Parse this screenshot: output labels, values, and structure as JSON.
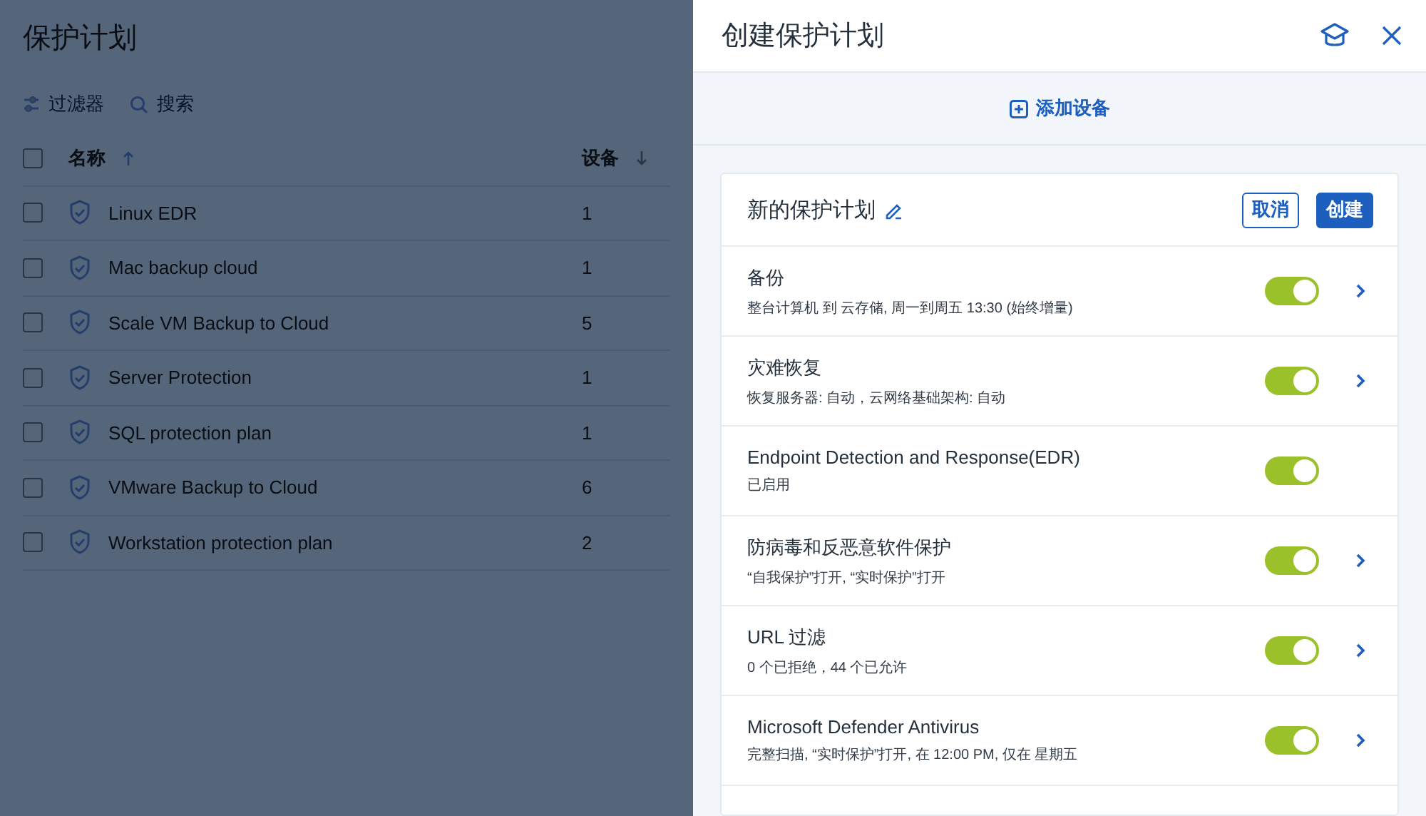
{
  "page": {
    "title": "保护计划",
    "toolbar": [
      "过滤器",
      "搜索"
    ],
    "table": {
      "columns": [
        "名称",
        "设备"
      ],
      "all_checked": false,
      "rows": [
        {
          "name": "Linux EDR",
          "devices": "1",
          "checked": false
        },
        {
          "name": "Mac backup cloud",
          "devices": "1",
          "checked": false
        },
        {
          "name": "Scale VM Backup to Cloud",
          "devices": "5",
          "checked": false
        },
        {
          "name": "Server Protection",
          "devices": "1",
          "checked": false
        },
        {
          "name": "SQL protection plan",
          "devices": "1",
          "checked": false
        },
        {
          "name": "VMware Backup to Cloud",
          "devices": "6",
          "checked": false
        },
        {
          "name": "Workstation protection plan",
          "devices": "2",
          "checked": false
        }
      ]
    }
  },
  "panel": {
    "title": "创建保护计划",
    "add_device": "添加设备",
    "plan": {
      "name": "新的保护计划",
      "buttons": [
        {
          "label": "取消",
          "kind": "secondary"
        },
        {
          "label": "创建",
          "kind": "primary"
        }
      ],
      "modules": [
        {
          "title": "备份",
          "summary": "整台计算机 到 云存储, 周一到周五 13:30 (始终增量)",
          "on": true,
          "has_details": true
        },
        {
          "title": "灾难恢复",
          "summary": "恢复服务器: 自动，云网络基础架构: 自动",
          "on": true,
          "has_details": true
        },
        {
          "title": "Endpoint Detection and Response(EDR)",
          "summary": "已启用",
          "on": true,
          "has_details": false
        },
        {
          "title": "防病毒和反恶意软件保护",
          "summary": "“自我保护”打开, “实时保护”打开",
          "on": true,
          "has_details": true
        },
        {
          "title": "URL 过滤",
          "summary": "0 个已拒绝，44 个已允许",
          "on": true,
          "has_details": true
        },
        {
          "title": "Microsoft Defender Antivirus",
          "summary": "完整扫描, “实时保护”打开, 在 12:00 PM, 仅在 星期五",
          "on": true,
          "has_details": true
        }
      ]
    }
  }
}
